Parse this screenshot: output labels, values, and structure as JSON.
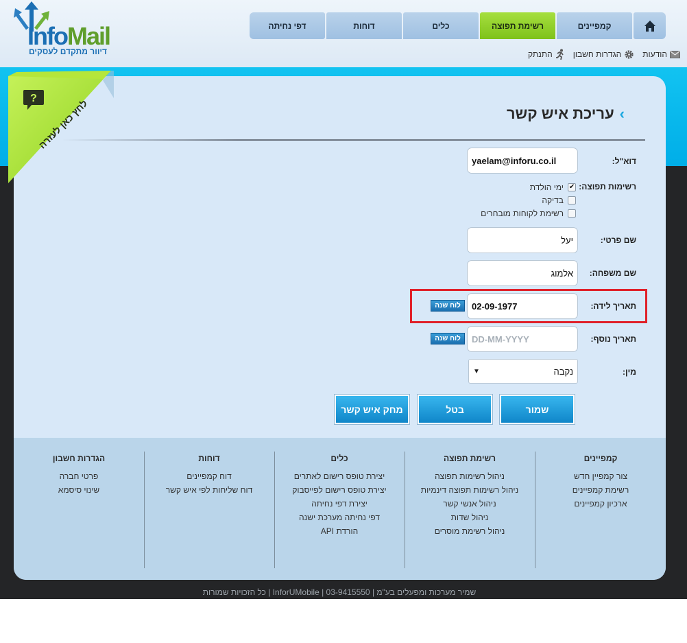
{
  "brand": {
    "logo_info": "Info",
    "logo_mail": "Mail",
    "tagline": "דיוור מתקדם לעסקים",
    "colors": {
      "blue": "#1b6fb4",
      "green": "#5f9e2c"
    }
  },
  "nav": {
    "tabs": [
      {
        "label": "דפי נחיתה"
      },
      {
        "label": "דוחות"
      },
      {
        "label": "כלים"
      },
      {
        "label": "רשימת תפוצה",
        "active": true
      },
      {
        "label": "קמפיינים"
      }
    ],
    "home_icon": "home-icon"
  },
  "subnav": {
    "messages": "הודעות",
    "settings": "הגדרות חשבון",
    "logout": "התנתק"
  },
  "help": {
    "label": "לחץ כאן לעזרה",
    "icon": "question-bubble-icon"
  },
  "form": {
    "title": "עריכת איש קשר",
    "email_label": "דוא\"ל:",
    "email_value": "yaelam@inforu.co.il",
    "lists_label": "רשימות תפוצה:",
    "lists": [
      {
        "label": "ימי הולדת",
        "checked": true
      },
      {
        "label": "בדיקה",
        "checked": false
      },
      {
        "label": "רשימת לקוחות מובחרים",
        "checked": false
      }
    ],
    "first_name_label": "שם פרטי:",
    "first_name_value": "יעל",
    "last_name_label": "שם משפחה:",
    "last_name_value": "אלמוג",
    "birth_date_label": "תאריך לידה:",
    "birth_date_value": "02-09-1977",
    "extra_date_label": "תאריך נוסף:",
    "extra_date_placeholder": "DD-MM-YYYY",
    "calendar_button": "לוח שנה",
    "gender_label": "מין:",
    "gender_value": "נקבה",
    "save_button": "שמור",
    "cancel_button": "בטל",
    "delete_button": "מחק איש קשר"
  },
  "footer": {
    "columns": [
      {
        "title": "קמפיינים",
        "links": [
          "צור קמפיין חדש",
          "רשימת קמפיינים",
          "ארכיון קמפיינים"
        ]
      },
      {
        "title": "רשימת תפוצה",
        "links": [
          "ניהול רשימות תפוצה",
          "ניהול רשימות תפוצה דינמיות",
          "ניהול אנשי קשר",
          "ניהול שדות",
          "ניהול רשימת מוסרים"
        ]
      },
      {
        "title": "כלים",
        "links": [
          "יצירת טופס רישום לאתרים",
          "יצירת טופס רישום לפייסבוק",
          "יצירת דפי נחיתה",
          "דפי נחיתה מערכת ישנה",
          "הורדת API"
        ]
      },
      {
        "title": "דוחות",
        "links": [
          "דוח קמפיינים",
          "דוח שליחות לפי איש קשר"
        ]
      },
      {
        "title": "הגדרות חשבון",
        "links": [
          "פרטי חברה",
          "שינוי סיסמא"
        ]
      }
    ],
    "copyright": "שמיר מערכות ומפעלים בע\"מ | 03-9415550 | InforUMobile | כל הזכויות שמורות"
  }
}
